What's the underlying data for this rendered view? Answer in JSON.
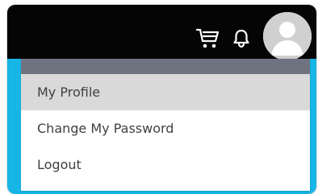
{
  "colors": {
    "topbar_bg": "#050505",
    "accent_blue": "#17b6e6",
    "menu_header_bg": "#6f7380",
    "menu_active_bg": "#d9d9d9"
  },
  "topbar": {
    "icons": [
      "cart-icon",
      "bell-icon"
    ],
    "avatar": "avatar"
  },
  "menu": {
    "items": [
      {
        "label": "My Profile",
        "active": true
      },
      {
        "label": "Change My Password",
        "active": false
      },
      {
        "label": "Logout",
        "active": false
      }
    ]
  }
}
